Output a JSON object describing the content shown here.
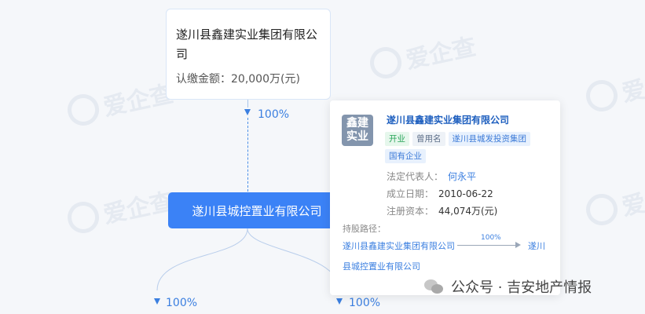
{
  "watermark_text": "爱企查",
  "top_node": {
    "name": "遂川县鑫建实业集团有限公司",
    "amount_label": "认缴金额：",
    "amount_value": "20,000万(元)"
  },
  "edge_top": {
    "percent": "100%"
  },
  "middle_node": {
    "name": "遂川县城控置业有限公司"
  },
  "edge_bottom_left": {
    "percent": "100%"
  },
  "edge_bottom_right": {
    "percent": "100%"
  },
  "card": {
    "logo_line1": "鑫建",
    "logo_line2": "实业",
    "title": "遂川县鑫建实业集团有限公司",
    "tags": [
      {
        "text": "开业",
        "style": "green"
      },
      {
        "text": "曾用名",
        "style": "gray"
      },
      {
        "text": "遂川县城发投资集团",
        "style": "blue"
      },
      {
        "text": "国有企业",
        "style": "blue"
      }
    ],
    "legal_rep_label": "法定代表人：",
    "legal_rep_value": "何永平",
    "founded_label": "成立日期：",
    "founded_value": "2010-06-22",
    "capital_label": "注册资本：",
    "capital_value": "44,074万(元)",
    "path_label": "持股路径：",
    "path_start": "遂川县鑫建实业集团有限公司",
    "path_percent": "100%",
    "path_end_part1": "遂川",
    "path_end_part2": "县城控置业有限公司"
  },
  "source": {
    "text": "公众号 · 吉安地产情报"
  },
  "colors": {
    "accent": "#3b82f6",
    "link": "#3b7fe0",
    "background": "#f5f7fa"
  }
}
